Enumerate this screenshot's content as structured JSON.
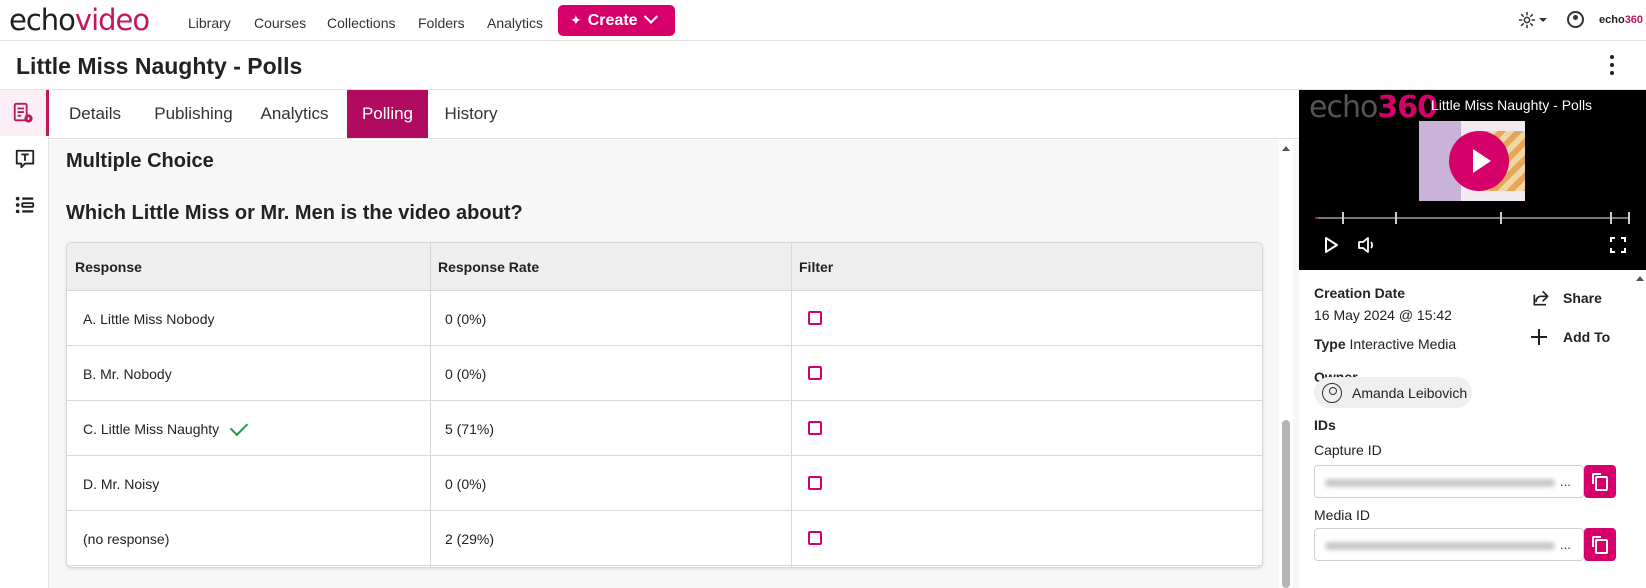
{
  "header": {
    "logo_part1": "echo",
    "logo_part2": "video",
    "nav": [
      "Library",
      "Courses",
      "Collections",
      "Folders",
      "Analytics"
    ],
    "create_label": "Create",
    "brand_small_1": "echo",
    "brand_small_2": "360"
  },
  "page": {
    "title": "Little Miss Naughty - Polls"
  },
  "tabs": [
    "Details",
    "Publishing",
    "Analytics",
    "Polling",
    "History"
  ],
  "active_tab": "Polling",
  "poll": {
    "section_title": "Multiple Choice",
    "question": "Which Little Miss or Mr. Men is the video about?",
    "columns": [
      "Response",
      "Response Rate",
      "Filter"
    ],
    "rows": [
      {
        "response": "A. Little Miss Nobody",
        "rate": "0 (0%)",
        "correct": false
      },
      {
        "response": "B. Mr. Nobody",
        "rate": "0 (0%)",
        "correct": false
      },
      {
        "response": "C. Little Miss Naughty",
        "rate": "5 (71%)",
        "correct": true
      },
      {
        "response": "D. Mr. Noisy",
        "rate": "0 (0%)",
        "correct": false
      },
      {
        "response": "(no response)",
        "rate": "2 (29%)",
        "correct": false
      }
    ]
  },
  "player": {
    "logo_part1": "echo",
    "logo_part2": "360",
    "title": "Little Miss Naughty - Polls"
  },
  "details": {
    "creation_date_label": "Creation Date",
    "creation_date": "16 May 2024 @ 15:42",
    "type_label": "Type",
    "type_value": "Interactive Media",
    "share_label": "Share",
    "add_to_label": "Add To",
    "owner_label": "Owner",
    "owner_name": "Amanda Leibovich",
    "ids_label": "IDs",
    "capture_id_label": "Capture ID",
    "media_id_label": "Media ID",
    "id_ellipsis": "..."
  },
  "colors": {
    "accent": "#d6006b",
    "active_tab": "#b00b5e",
    "check": "#1a9e4b"
  }
}
